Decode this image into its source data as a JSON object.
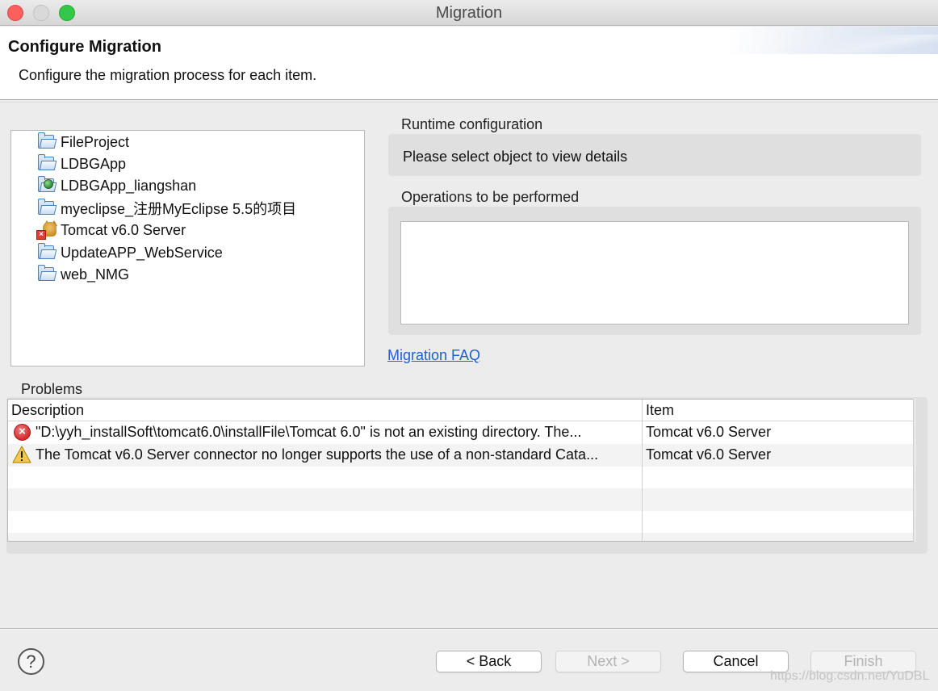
{
  "window": {
    "title": "Migration"
  },
  "header": {
    "title": "Configure Migration",
    "subtitle": "Configure the migration process for each item."
  },
  "tree": {
    "items": [
      {
        "label": "FileProject",
        "icon": "folder-icon"
      },
      {
        "label": "LDBGApp",
        "icon": "folder-icon"
      },
      {
        "label": "LDBGApp_liangshan",
        "icon": "web-project-folder-icon"
      },
      {
        "label": "myeclipse_注册MyEclipse 5.5的项目",
        "icon": "folder-icon"
      },
      {
        "label": "Tomcat v6.0 Server",
        "icon": "tomcat-server-error-icon"
      },
      {
        "label": "UpdateAPP_WebService",
        "icon": "folder-icon"
      },
      {
        "label": "web_NMG",
        "icon": "folder-icon"
      }
    ]
  },
  "runtime": {
    "label": "Runtime configuration",
    "message": "Please select object to view details"
  },
  "operations": {
    "label": "Operations to be performed"
  },
  "faq_link": "Migration FAQ",
  "problems": {
    "label": "Problems",
    "columns": [
      "Description",
      "Item"
    ],
    "rows": [
      {
        "severity": "error",
        "description": "\"D:\\yyh_installSoft\\tomcat6.0\\installFile\\Tomcat 6.0\" is not an existing directory. The...",
        "item": "Tomcat v6.0 Server"
      },
      {
        "severity": "warning",
        "description": "The Tomcat v6.0 Server connector no longer supports the use of a non-standard Cata...",
        "item": "Tomcat v6.0 Server"
      }
    ]
  },
  "buttons": {
    "help": "?",
    "back": "< Back",
    "next": "Next >",
    "cancel": "Cancel",
    "finish": "Finish"
  },
  "watermark": "https://blog.csdn.net/YuDBL",
  "colors": {
    "close": "#fc605c",
    "minimize": "#d9d9d9",
    "maximize": "#34c84a",
    "link": "#1f5fcf",
    "error": "#d42a2a",
    "warning": "#f2c94c"
  }
}
